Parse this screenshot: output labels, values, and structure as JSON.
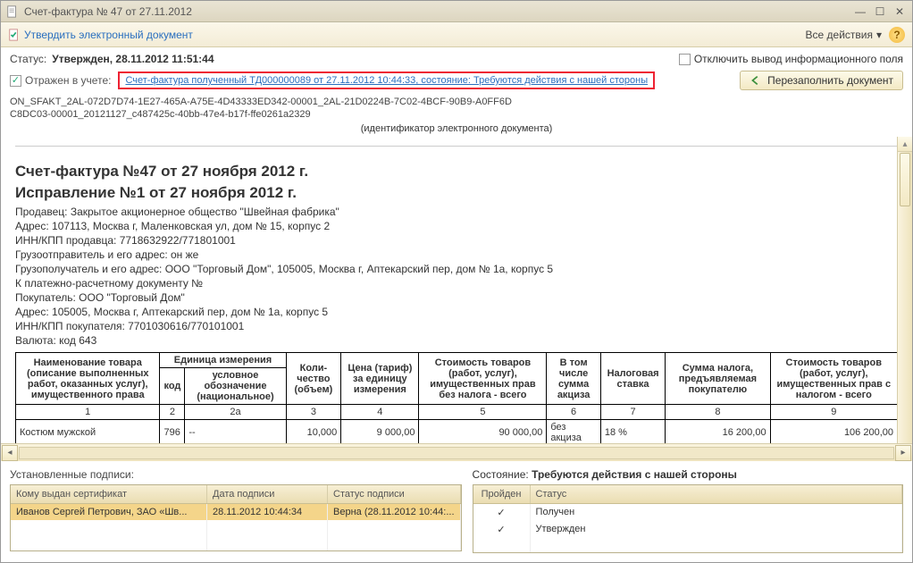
{
  "window": {
    "title": "Счет-фактура № 47 от 27.11.2012"
  },
  "toolbar": {
    "approve_label": "Утвердить электронный документ",
    "all_actions_label": "Все действия",
    "help_label": "?"
  },
  "status": {
    "label": "Статус:",
    "value": "Утвержден, 28.11.2012 11:51:44",
    "disable_info_label": "Отключить вывод информационного поля"
  },
  "reflected": {
    "label": "Отражен в учете:",
    "link": "Счет-фактура полученный ТД000000089 от 27.11.2012 10:44:33, состояние: Требуются действия с нашей стороны"
  },
  "refill_button": "Перезаполнить документ",
  "tech": {
    "line1": "ON_SFAKT_2AL-072D7D74-1E27-465A-A75E-4D43333ED342-00001_2AL-21D0224B-7C02-4BCF-90B9-A0FF6D",
    "line2": "C8DC03-00001_20121127_c487425c-40bb-47e4-b17f-ffe0261a2329",
    "edoc_label": "(идентификатор электронного документа)"
  },
  "doc": {
    "title1": "Счет-фактура №47 от 27 ноября 2012 г.",
    "title2": "Исправление №1 от 27 ноября 2012 г.",
    "seller": "Продавец: Закрытое акционерное общество \"Швейная фабрика\"",
    "addr1": "Адрес: 107113, Москва г, Маленковская ул, дом № 15, корпус 2",
    "inn_seller": "ИНН/КПП продавца: 7718632922/771801001",
    "shipper": "Грузоотправитель и его адрес: он же",
    "consignee": "Грузополучатель и его адрес: ООО \"Торговый Дом\", 105005, Москва г, Аптекарский пер, дом № 1а, корпус 5",
    "payment": "К платежно-расчетному документу №",
    "buyer": "Покупатель: ООО \"Торговый Дом\"",
    "addr2": "Адрес: 105005, Москва г, Аптекарский пер, дом № 1а, корпус 5",
    "inn_buyer": "ИНН/КПП покупателя: 7701030616/770101001",
    "currency": "Валюта: код 643"
  },
  "table": {
    "headers": {
      "name": "Наименование товара (описание выполненных работ, оказанных услуг), имущественного права",
      "unit": "Единица измерения",
      "code": "код",
      "unit_name": "условное обозначение (национальное)",
      "qty": "Коли-чество (объем)",
      "price": "Цена (тариф) за единицу измерения",
      "cost_notax": "Стоимость товаров (работ, услуг), имущественных прав без налога - всего",
      "excise": "В том числе сумма акциза",
      "tax_rate": "Налоговая ставка",
      "tax_sum": "Сумма налога, предъявляемая покупателю",
      "cost_tax": "Стоимость товаров (работ, услуг), имущественных прав с налогом - всего"
    },
    "nums": [
      "1",
      "2",
      "2а",
      "3",
      "4",
      "5",
      "6",
      "7",
      "8",
      "9"
    ],
    "row": {
      "name": "Костюм мужской",
      "code": "796",
      "unit_name": "--",
      "qty": "10,000",
      "price": "9 000,00",
      "cost_notax": "90 000,00",
      "excise": "без акциза",
      "tax_rate": "18 %",
      "tax_sum": "16 200,00",
      "cost_tax": "106 200,00"
    }
  },
  "signatures": {
    "title": "Установленные подписи:",
    "headers": {
      "who": "Кому выдан сертификат",
      "date": "Дата подписи",
      "status": "Статус подписи"
    },
    "rows": [
      {
        "who": "Иванов Сергей Петрович, ЗАО «Шв...",
        "date": "28.11.2012 10:44:34",
        "status": "Верна (28.11.2012 10:44:..."
      }
    ]
  },
  "state": {
    "title_label": "Состояние:",
    "title_value": "Требуются действия с нашей стороны",
    "headers": {
      "passed": "Пройден",
      "status": "Статус"
    },
    "rows": [
      {
        "passed": "✓",
        "status": "Получен"
      },
      {
        "passed": "✓",
        "status": "Утвержден"
      }
    ]
  }
}
